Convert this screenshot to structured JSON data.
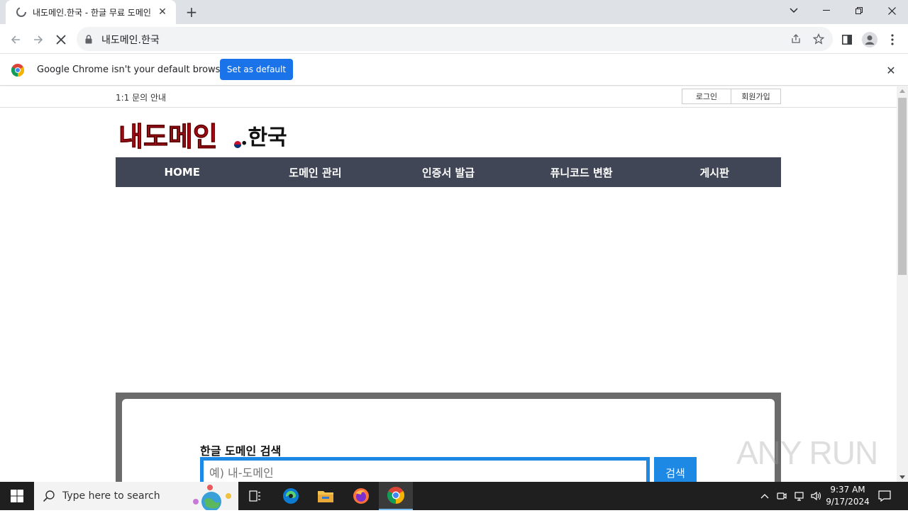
{
  "browser": {
    "tab_title": "내도메인.한국 - 한글 무료 도메인",
    "url": "내도메인.한국"
  },
  "infobar": {
    "message": "Google Chrome isn't your default browser",
    "button": "Set as default"
  },
  "page": {
    "top_link": "1:1 문의 안내",
    "login": "로그인",
    "signup": "회원가입",
    "logo_text": "내도메인",
    "logo_suffix": ".한국",
    "nav": [
      "HOME",
      "도메인 관리",
      "인증서 발급",
      "퓨니코드 변환",
      "게시판"
    ],
    "search_title": "한글 도메인 검색",
    "search_placeholder": "예) 내-도메인",
    "search_button": "검색"
  },
  "watermark": "ANY RUN",
  "taskbar": {
    "search_placeholder": "Type here to search",
    "time": "9:37 AM",
    "date": "9/17/2024"
  },
  "colors": {
    "nav_bg": "#414656",
    "accent_blue": "#1e88e5",
    "chrome_button": "#1a73e8"
  }
}
